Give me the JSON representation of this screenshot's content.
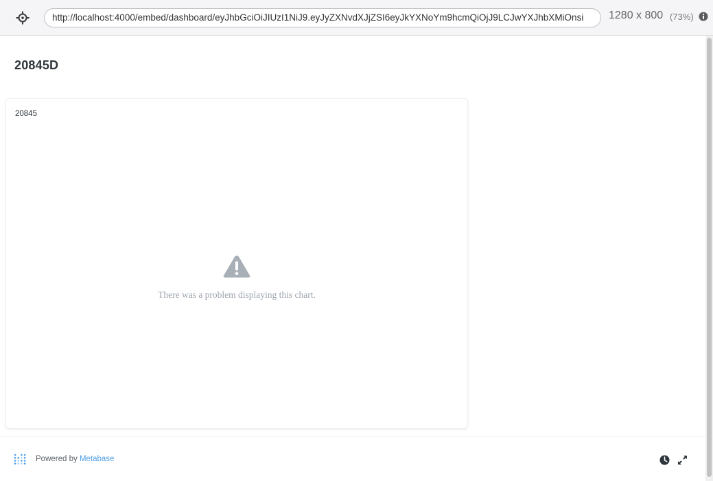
{
  "browser": {
    "url": "http://localhost:4000/embed/dashboard/eyJhbGciOiJIUzI1NiJ9.eyJyZXNvdXJjZSI6eyJkYXNoYm9hcmQiOjJ9LCJwYXJhbXMiOnsi",
    "viewport_size": "1280 x 800",
    "zoom": "(73%)",
    "icons": {
      "target": "crosshair-icon",
      "info": "info-icon"
    }
  },
  "dashboard": {
    "title": "20845D",
    "card": {
      "title": "20845",
      "error_message": "There was a problem displaying this chart.",
      "error_icon": "warning-icon"
    }
  },
  "footer": {
    "powered_by": "Powered by",
    "brand_link": "Metabase",
    "icons": {
      "logo": "metabase-logo-icon",
      "refresh": "clock-icon",
      "fullscreen": "expand-icon"
    }
  },
  "colors": {
    "brand": "#509ee3",
    "error_icon": "#a9afb6",
    "error_text": "#9ea5ad",
    "title_text": "#2e353b"
  }
}
